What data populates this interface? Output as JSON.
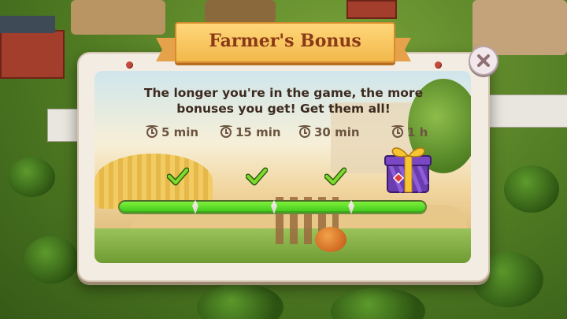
{
  "dialog": {
    "title": "Farmer's Bonus",
    "message_line1": "The longer you're in the game, the more",
    "message_line2": "bonuses you get! Get them all!",
    "tiers": [
      {
        "label": "5 min",
        "completed": true
      },
      {
        "label": "15 min",
        "completed": true
      },
      {
        "label": "30 min",
        "completed": true
      },
      {
        "label": "1 h",
        "completed": false
      }
    ],
    "progress_fraction": 1.0,
    "reward_icon": "gift-box-icon",
    "close_icon": "close-icon"
  },
  "colors": {
    "progress_fill": "#4fd324",
    "title_text": "#8b3a17",
    "banner": "#f2b84c",
    "check": "#63c31f"
  }
}
